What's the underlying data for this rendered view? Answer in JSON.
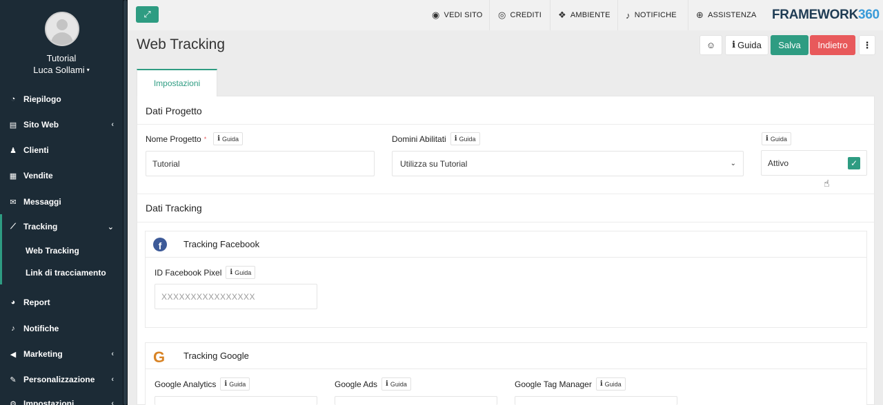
{
  "user": {
    "company": "Tutorial",
    "name": "Luca Sollami",
    "caret": "▾"
  },
  "sidebar": {
    "items": [
      {
        "label": "Riepilogo",
        "icon": "dashboard-icon",
        "glyph": "◔",
        "chevron": ""
      },
      {
        "label": "Sito Web",
        "icon": "file-icon",
        "glyph": "▤",
        "chevron": "‹"
      },
      {
        "label": "Clienti",
        "icon": "user-icon",
        "glyph": "♟",
        "chevron": ""
      },
      {
        "label": "Vendite",
        "icon": "calculator-icon",
        "glyph": "▦",
        "chevron": ""
      },
      {
        "label": "Messaggi",
        "icon": "envelope-icon",
        "glyph": "✉",
        "chevron": ""
      },
      {
        "label": "Tracking",
        "icon": "line-chart-icon",
        "glyph": "⟋",
        "chevron": "⌄"
      },
      {
        "label": "Report",
        "icon": "pie-chart-icon",
        "glyph": "◕",
        "chevron": ""
      },
      {
        "label": "Notifiche",
        "icon": "bell-icon",
        "glyph": "♪",
        "chevron": ""
      },
      {
        "label": "Marketing",
        "icon": "bullhorn-icon",
        "glyph": "◀",
        "chevron": "‹"
      },
      {
        "label": "Personalizzazione",
        "icon": "brush-icon",
        "glyph": "✎",
        "chevron": "‹"
      },
      {
        "label": "Impostazioni",
        "icon": "gear-icon",
        "glyph": "⚙",
        "chevron": "‹"
      }
    ],
    "tracking_sub": [
      "Web Tracking",
      "Link di tracciamento"
    ]
  },
  "topbar": {
    "expand_glyph": "⤢",
    "links": [
      {
        "label": "VEDI SITO",
        "glyph": "◉"
      },
      {
        "label": "CREDITI",
        "glyph": "◎"
      },
      {
        "label": "AMBIENTE",
        "glyph": "❖"
      },
      {
        "label": "NOTIFICHE",
        "glyph": "♪"
      },
      {
        "label": "ASSISTENZA",
        "glyph": "⊕"
      }
    ],
    "brand_text": "FRAMEWORK",
    "brand_num": "360"
  },
  "page": {
    "title": "Web Tracking",
    "smile_glyph": "☺",
    "guida_label": "Guida",
    "save_label": "Salva",
    "back_label": "Indietro",
    "more_glyph": "⋮"
  },
  "tabs": [
    "Impostazioni"
  ],
  "project": {
    "section_title": "Dati Progetto",
    "name_label": "Nome Progetto",
    "required_mark": "*",
    "name_value": "Tutorial",
    "domains_label": "Domini Abilitati",
    "domains_value": "Utilizza su Tutorial",
    "status_value": "Attivo",
    "check_glyph": "✓",
    "guida": "Guida"
  },
  "tracking": {
    "section_title": "Dati Tracking",
    "facebook": {
      "title": "Tracking Facebook",
      "icon_glyph": "f",
      "pixel_label": "ID Facebook Pixel",
      "pixel_placeholder": "XXXXXXXXXXXXXXXX"
    },
    "google": {
      "title": "Tracking Google",
      "icon_glyph": "G",
      "analytics_label": "Google Analytics",
      "ads_label": "Google Ads",
      "gtm_label": "Google Tag Manager"
    }
  },
  "colors": {
    "accent": "#2e9c82",
    "danger": "#e8595b",
    "sidebar": "#1c2b36",
    "brand": "#1f3c54",
    "brand_num": "#3a9bd9"
  }
}
